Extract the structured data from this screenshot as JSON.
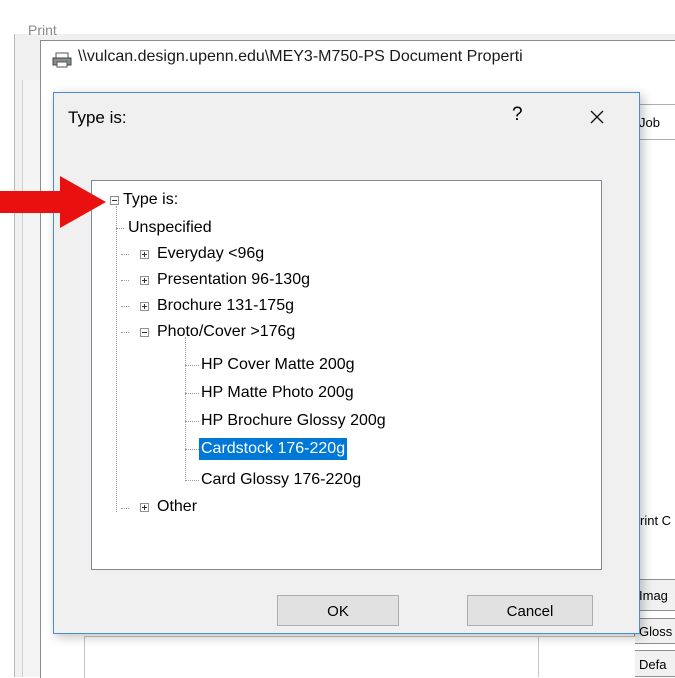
{
  "background": {
    "print_window_label": "Print",
    "doc_properties_title": "\\\\vulcan.design.upenn.edu\\MEY3-M750-PS Document Properti",
    "side_tab_label": "Job",
    "side_print_label": "rint C",
    "side_buttons": [
      "Imag",
      "Gloss",
      "Defa"
    ]
  },
  "dialog": {
    "title": "Type is:",
    "help_label": "?",
    "close_icon": "close-icon",
    "tree": {
      "root": "Type is:",
      "items": [
        "Unspecified",
        "Everyday <96g",
        "Presentation 96-130g",
        "Brochure 131-175g",
        "Photo/Cover >176g",
        "HP Cover Matte 200g",
        "HP Matte Photo 200g",
        "HP Brochure Glossy 200g",
        "Cardstock 176-220g",
        "Card Glossy 176-220g",
        "Other"
      ],
      "selected": "Cardstock 176-220g"
    },
    "ok_label": "OK",
    "cancel_label": "Cancel"
  },
  "colors": {
    "selection": "#0078d7",
    "arrow": "#e8110f",
    "dialog_border": "#4a8cd6"
  }
}
